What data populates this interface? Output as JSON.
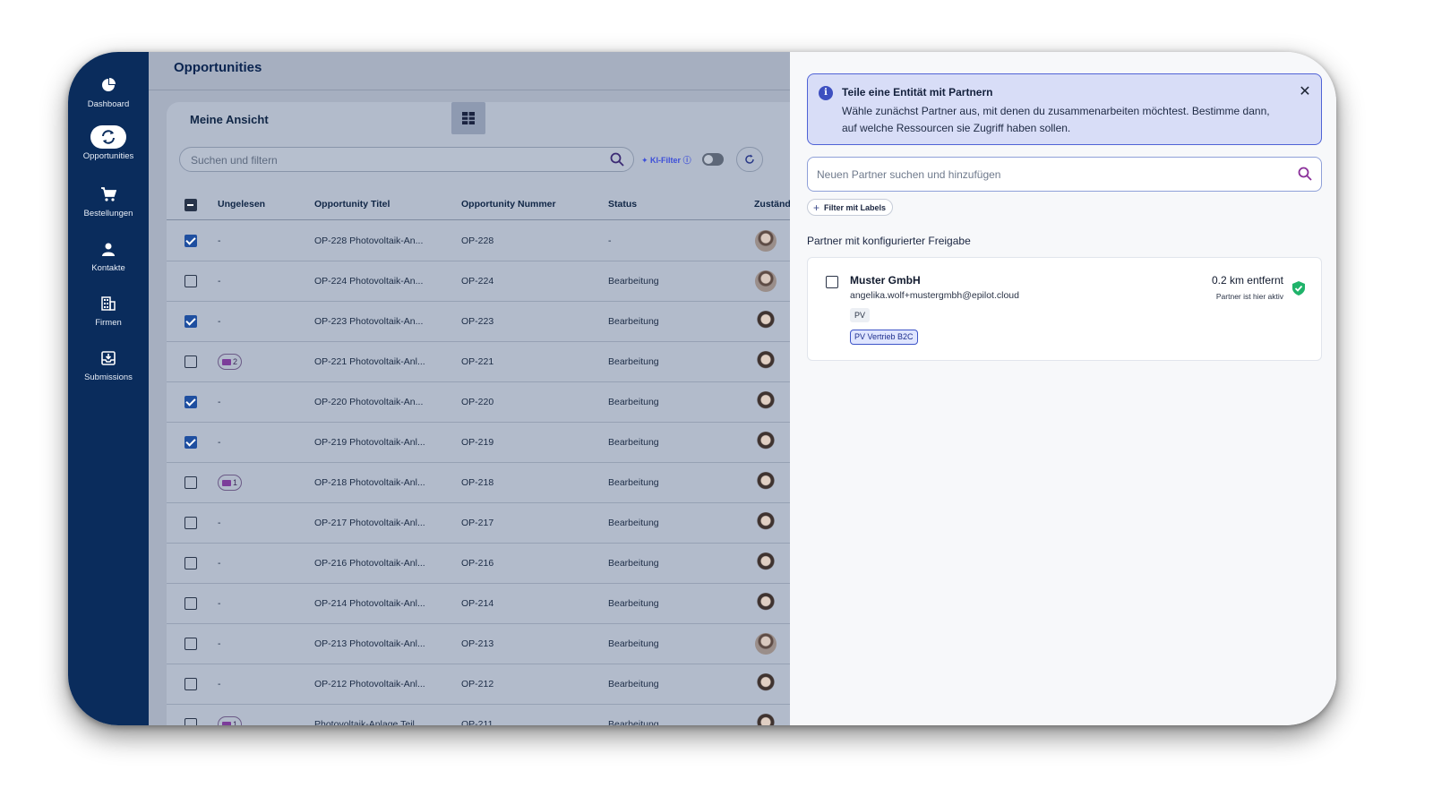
{
  "sidebar": {
    "items": [
      {
        "label": "Dashboard",
        "icon": "pie-chart-icon"
      },
      {
        "label": "Opportunities",
        "icon": "refresh-cycle-icon"
      },
      {
        "label": "Bestellungen",
        "icon": "cart-icon"
      },
      {
        "label": "Kontakte",
        "icon": "person-icon"
      },
      {
        "label": "Firmen",
        "icon": "building-icon"
      },
      {
        "label": "Submissions",
        "icon": "inbox-icon"
      }
    ]
  },
  "main": {
    "title": "Opportunities",
    "view_tab": "Meine Ansicht",
    "search_placeholder": "Suchen und filtern",
    "ki_filter_label": "KI-Filter",
    "columns": [
      "Ungelesen",
      "Opportunity Titel",
      "Opportunity Nummer",
      "Status",
      "Zuständ"
    ],
    "rows": [
      {
        "checked": true,
        "unread": "-",
        "title": "OP-228 Photovoltaik-An...",
        "number": "OP-228",
        "status": "-"
      },
      {
        "checked": false,
        "unread": "-",
        "title": "OP-224 Photovoltaik-An...",
        "number": "OP-224",
        "status": "Bearbeitung"
      },
      {
        "checked": true,
        "unread": "-",
        "title": "OP-223 Photovoltaik-An...",
        "number": "OP-223",
        "status": "Bearbeitung"
      },
      {
        "checked": false,
        "unread": "2",
        "title": "OP-221 Photovoltaik-Anl...",
        "number": "OP-221",
        "status": "Bearbeitung"
      },
      {
        "checked": true,
        "unread": "-",
        "title": "OP-220 Photovoltaik-An...",
        "number": "OP-220",
        "status": "Bearbeitung"
      },
      {
        "checked": true,
        "unread": "-",
        "title": "OP-219 Photovoltaik-Anl...",
        "number": "OP-219",
        "status": "Bearbeitung"
      },
      {
        "checked": false,
        "unread": "1",
        "title": "OP-218 Photovoltaik-Anl...",
        "number": "OP-218",
        "status": "Bearbeitung"
      },
      {
        "checked": false,
        "unread": "-",
        "title": "OP-217 Photovoltaik-Anl...",
        "number": "OP-217",
        "status": "Bearbeitung"
      },
      {
        "checked": false,
        "unread": "-",
        "title": "OP-216 Photovoltaik-Anl...",
        "number": "OP-216",
        "status": "Bearbeitung"
      },
      {
        "checked": false,
        "unread": "-",
        "title": "OP-214 Photovoltaik-Anl...",
        "number": "OP-214",
        "status": "Bearbeitung"
      },
      {
        "checked": false,
        "unread": "-",
        "title": "OP-213 Photovoltaik-Anl...",
        "number": "OP-213",
        "status": "Bearbeitung"
      },
      {
        "checked": false,
        "unread": "-",
        "title": "OP-212 Photovoltaik-Anl...",
        "number": "OP-212",
        "status": "Bearbeitung"
      },
      {
        "checked": false,
        "unread": "1",
        "title": "Photovoltaik-Anlage Teil...",
        "number": "OP-211",
        "status": "Bearbeitung"
      }
    ]
  },
  "panel": {
    "info_title": "Teile eine Entität mit Partnern",
    "info_text": "Wähle zunächst Partner aus, mit denen du zusammenarbeiten möchtest. Bestimme dann, auf welche Ressourcen sie Zugriff haben sollen.",
    "search_placeholder": "Neuen Partner suchen und hinzufügen",
    "filter_chip": "Filter mit Labels",
    "section_label": "Partner mit konfigurierter Freigabe",
    "partner": {
      "name": "Muster GmbH",
      "email": "angelika.wolf+mustergmbh@epilot.cloud",
      "tag": "PV",
      "label": "PV Vertrieb B2C",
      "distance": "0.2 km entfernt",
      "status": "Partner ist hier aktiv"
    }
  },
  "colors": {
    "sidebar": "#0a2c5c",
    "accent": "#3d4fc0",
    "active_check": "#1fb36a"
  }
}
